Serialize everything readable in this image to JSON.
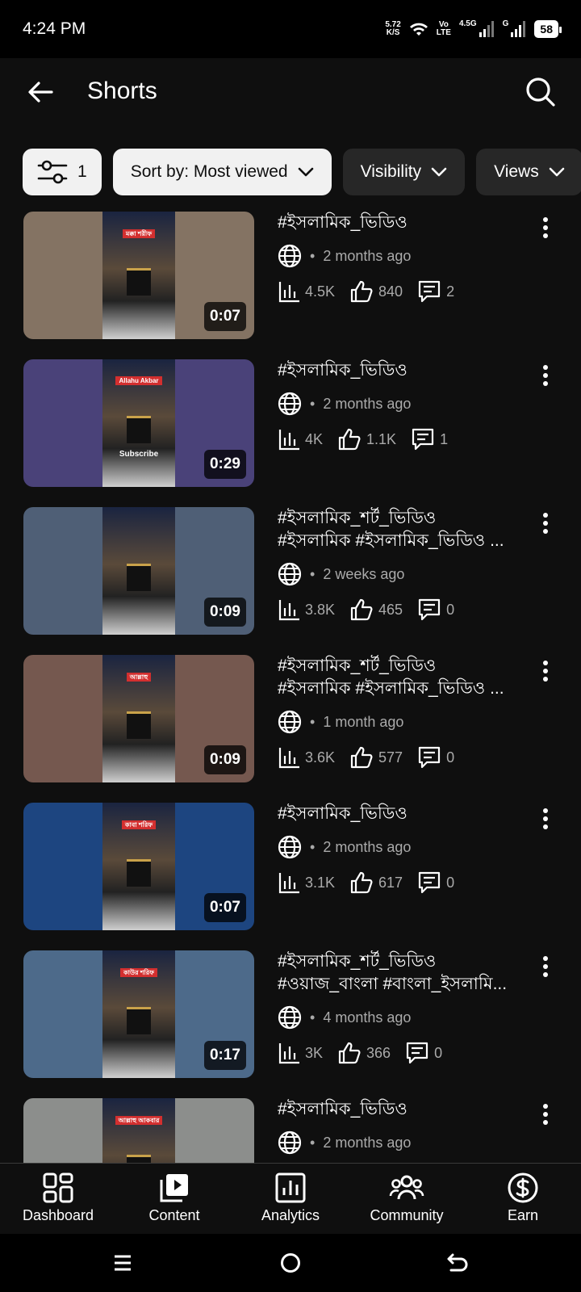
{
  "status": {
    "time": "4:24 PM",
    "net_speed_value": "5.72",
    "net_speed_unit": "K/S",
    "volte_top": "Vo",
    "volte_bottom": "LTE",
    "network_1": "4.5G",
    "network_2": "G",
    "battery": "58"
  },
  "header": {
    "title": "Shorts"
  },
  "filters": {
    "filter_count": "1",
    "sort_label": "Sort by: Most viewed",
    "visibility_label": "Visibility",
    "views_label": "Views"
  },
  "videos": [
    {
      "title": "#ইসলামিক_ভিডিও",
      "title2": "",
      "age": "2 months ago",
      "views": "4.5K",
      "likes": "840",
      "comments": "2",
      "duration": "0:07",
      "caption_top": "মক্কা শরীফ",
      "caption_bottom": "",
      "bg": "#847363"
    },
    {
      "title": "#ইসলামিক_ভিডিও",
      "title2": "",
      "age": "2 months ago",
      "views": "4K",
      "likes": "1.1K",
      "comments": "1",
      "duration": "0:29",
      "caption_top": "Allahu Akbar",
      "caption_bottom": "Subscribe",
      "bg": "#4a4279"
    },
    {
      "title": "#ইসলামিক_শর্ট_ভিডিও",
      "title2": "#ইসলামিক #ইসলামিক_ভিডিও ...",
      "age": "2 weeks ago",
      "views": "3.8K",
      "likes": "465",
      "comments": "0",
      "duration": "0:09",
      "caption_top": "",
      "caption_bottom": "",
      "bg": "#4f5f76"
    },
    {
      "title": "#ইসলামিক_শর্ট_ভিডিও",
      "title2": "#ইসলামিক #ইসলামিক_ভিডিও ...",
      "age": "1 month ago",
      "views": "3.6K",
      "likes": "577",
      "comments": "0",
      "duration": "0:09",
      "caption_top": "আল্লাহু",
      "caption_bottom": "",
      "bg": "#75584f"
    },
    {
      "title": "#ইসলামিক_ভিডিও",
      "title2": "",
      "age": "2 months ago",
      "views": "3.1K",
      "likes": "617",
      "comments": "0",
      "duration": "0:07",
      "caption_top": "কাবা শরিফ",
      "caption_bottom": "",
      "bg": "#1d4580"
    },
    {
      "title": "#ইসলামিক_শর্ট_ভিডিও",
      "title2": "#ওয়াজ_বাংলা #বাংলা_ইসলামি...",
      "age": "4 months ago",
      "views": "3K",
      "likes": "366",
      "comments": "0",
      "duration": "0:17",
      "caption_top": "কাউর শরিফ",
      "caption_bottom": "",
      "bg": "#4d6a8a"
    },
    {
      "title": "#ইসলামিক_ভিডিও",
      "title2": "",
      "age": "2 months ago",
      "views": "",
      "likes": "",
      "comments": "",
      "duration": "",
      "caption_top": "আল্লাহু আকবার",
      "caption_bottom": "",
      "bg": "#8c8e8c"
    }
  ],
  "nav": {
    "dashboard": "Dashboard",
    "content": "Content",
    "analytics": "Analytics",
    "community": "Community",
    "earn": "Earn"
  },
  "icons": [
    "back-arrow-icon",
    "search-icon",
    "filter-sliders-icon",
    "chevron-down-icon",
    "globe-icon",
    "bar-chart-icon",
    "thumbs-up-icon",
    "comment-icon",
    "more-vert-icon",
    "dashboard-icon",
    "content-icon",
    "analytics-icon",
    "community-icon",
    "earn-icon"
  ]
}
